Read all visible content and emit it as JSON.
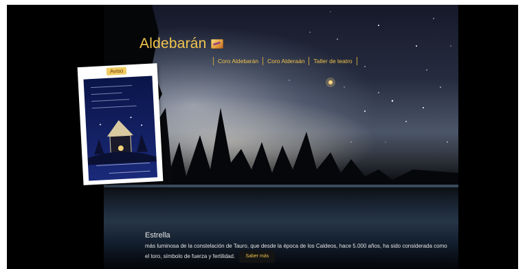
{
  "site": {
    "title": "Aldebarán",
    "logo_icon": "aldebaran-logo-icon"
  },
  "nav": {
    "items": [
      {
        "label": "Coro Aldebarán"
      },
      {
        "label": "Coro Alderaán"
      },
      {
        "label": "Taller de teatro"
      }
    ]
  },
  "notice": {
    "tab_label": "Aviso",
    "image_icon": "christmas-card-image"
  },
  "slide": {
    "title": "Estrella",
    "text": "más luminosa de la constelación de Tauro, que desde la época de los Caldeos, hace 5.000 años, ha sido considerada como el toro, símbolo de fuerza y fertilidad.",
    "more_label": "Saber más"
  },
  "colors": {
    "accent": "#f0c24a",
    "background": "#000000"
  }
}
